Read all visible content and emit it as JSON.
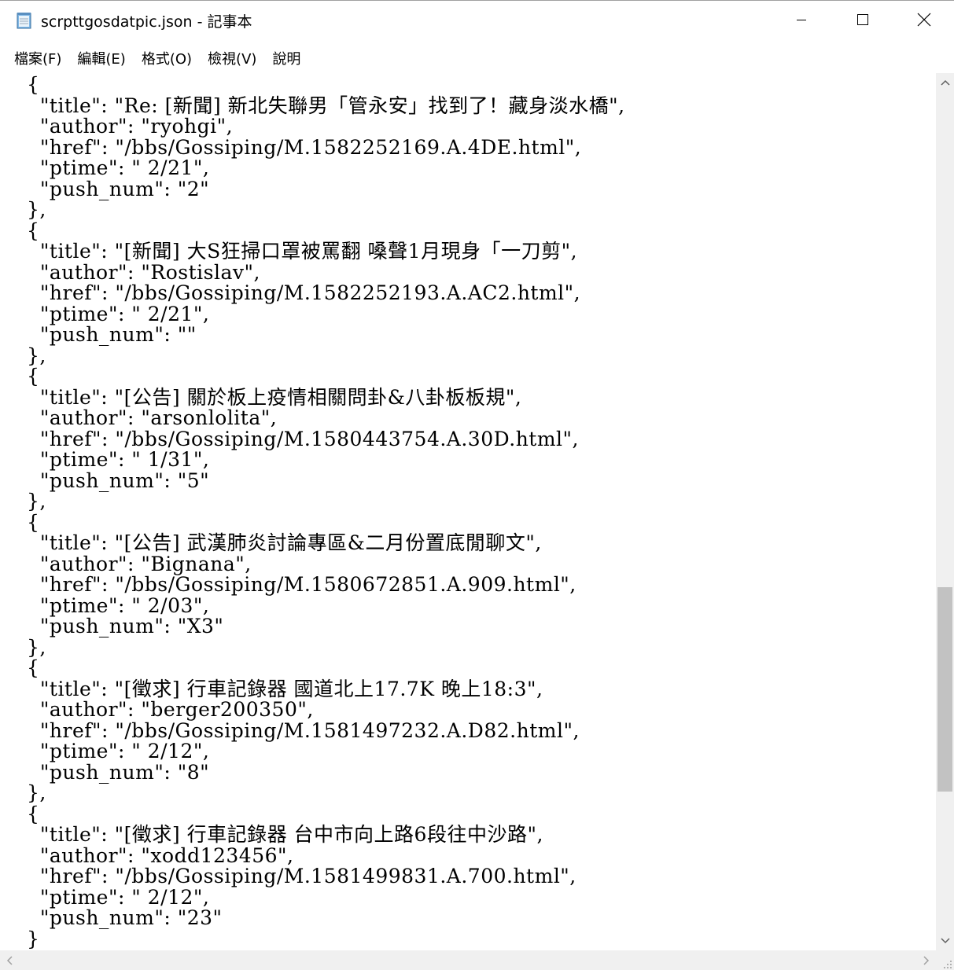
{
  "window": {
    "title": "scrpttgosdatpic.json - 記事本",
    "icon": "notepad-icon"
  },
  "menu": {
    "items": [
      "檔案(F)",
      "編輯(E)",
      "格式(O)",
      "檢視(V)",
      "說明"
    ]
  },
  "editor": {
    "lines": [
      "{",
      "  \"title\": \"Re: [新聞] 新北失聯男「管永安」找到了！藏身淡水橋\",",
      "  \"author\": \"ryohgi\",",
      "  \"href\": \"/bbs/Gossiping/M.1582252169.A.4DE.html\",",
      "  \"ptime\": \" 2/21\",",
      "  \"push_num\": \"2\"",
      "},",
      "{",
      "  \"title\": \"[新聞] 大S狂掃口罩被罵翻 嗓聲1月現身「一刀剪\",",
      "  \"author\": \"Rostislav\",",
      "  \"href\": \"/bbs/Gossiping/M.1582252193.A.AC2.html\",",
      "  \"ptime\": \" 2/21\",",
      "  \"push_num\": \"\"",
      "},",
      "{",
      "  \"title\": \"[公告] 關於板上疫情相關問卦&八卦板板規\",",
      "  \"author\": \"arsonlolita\",",
      "  \"href\": \"/bbs/Gossiping/M.1580443754.A.30D.html\",",
      "  \"ptime\": \" 1/31\",",
      "  \"push_num\": \"5\"",
      "},",
      "{",
      "  \"title\": \"[公告] 武漢肺炎討論專區&二月份置底閒聊文\",",
      "  \"author\": \"Bignana\",",
      "  \"href\": \"/bbs/Gossiping/M.1580672851.A.909.html\",",
      "  \"ptime\": \" 2/03\",",
      "  \"push_num\": \"X3\"",
      "},",
      "{",
      "  \"title\": \"[徵求] 行車記錄器 國道北上17.7K 晚上18:3\",",
      "  \"author\": \"berger200350\",",
      "  \"href\": \"/bbs/Gossiping/M.1581497232.A.D82.html\",",
      "  \"ptime\": \" 2/12\",",
      "  \"push_num\": \"8\"",
      "},",
      "{",
      "  \"title\": \"[徵求] 行車記錄器 台中市向上路6段往中沙路\",",
      "  \"author\": \"xodd123456\",",
      "  \"href\": \"/bbs/Gossiping/M.1581499831.A.700.html\",",
      "  \"ptime\": \" 2/12\",",
      "  \"push_num\": \"23\"",
      "}"
    ]
  },
  "scrollbar": {
    "vertical_position": 0.78
  }
}
